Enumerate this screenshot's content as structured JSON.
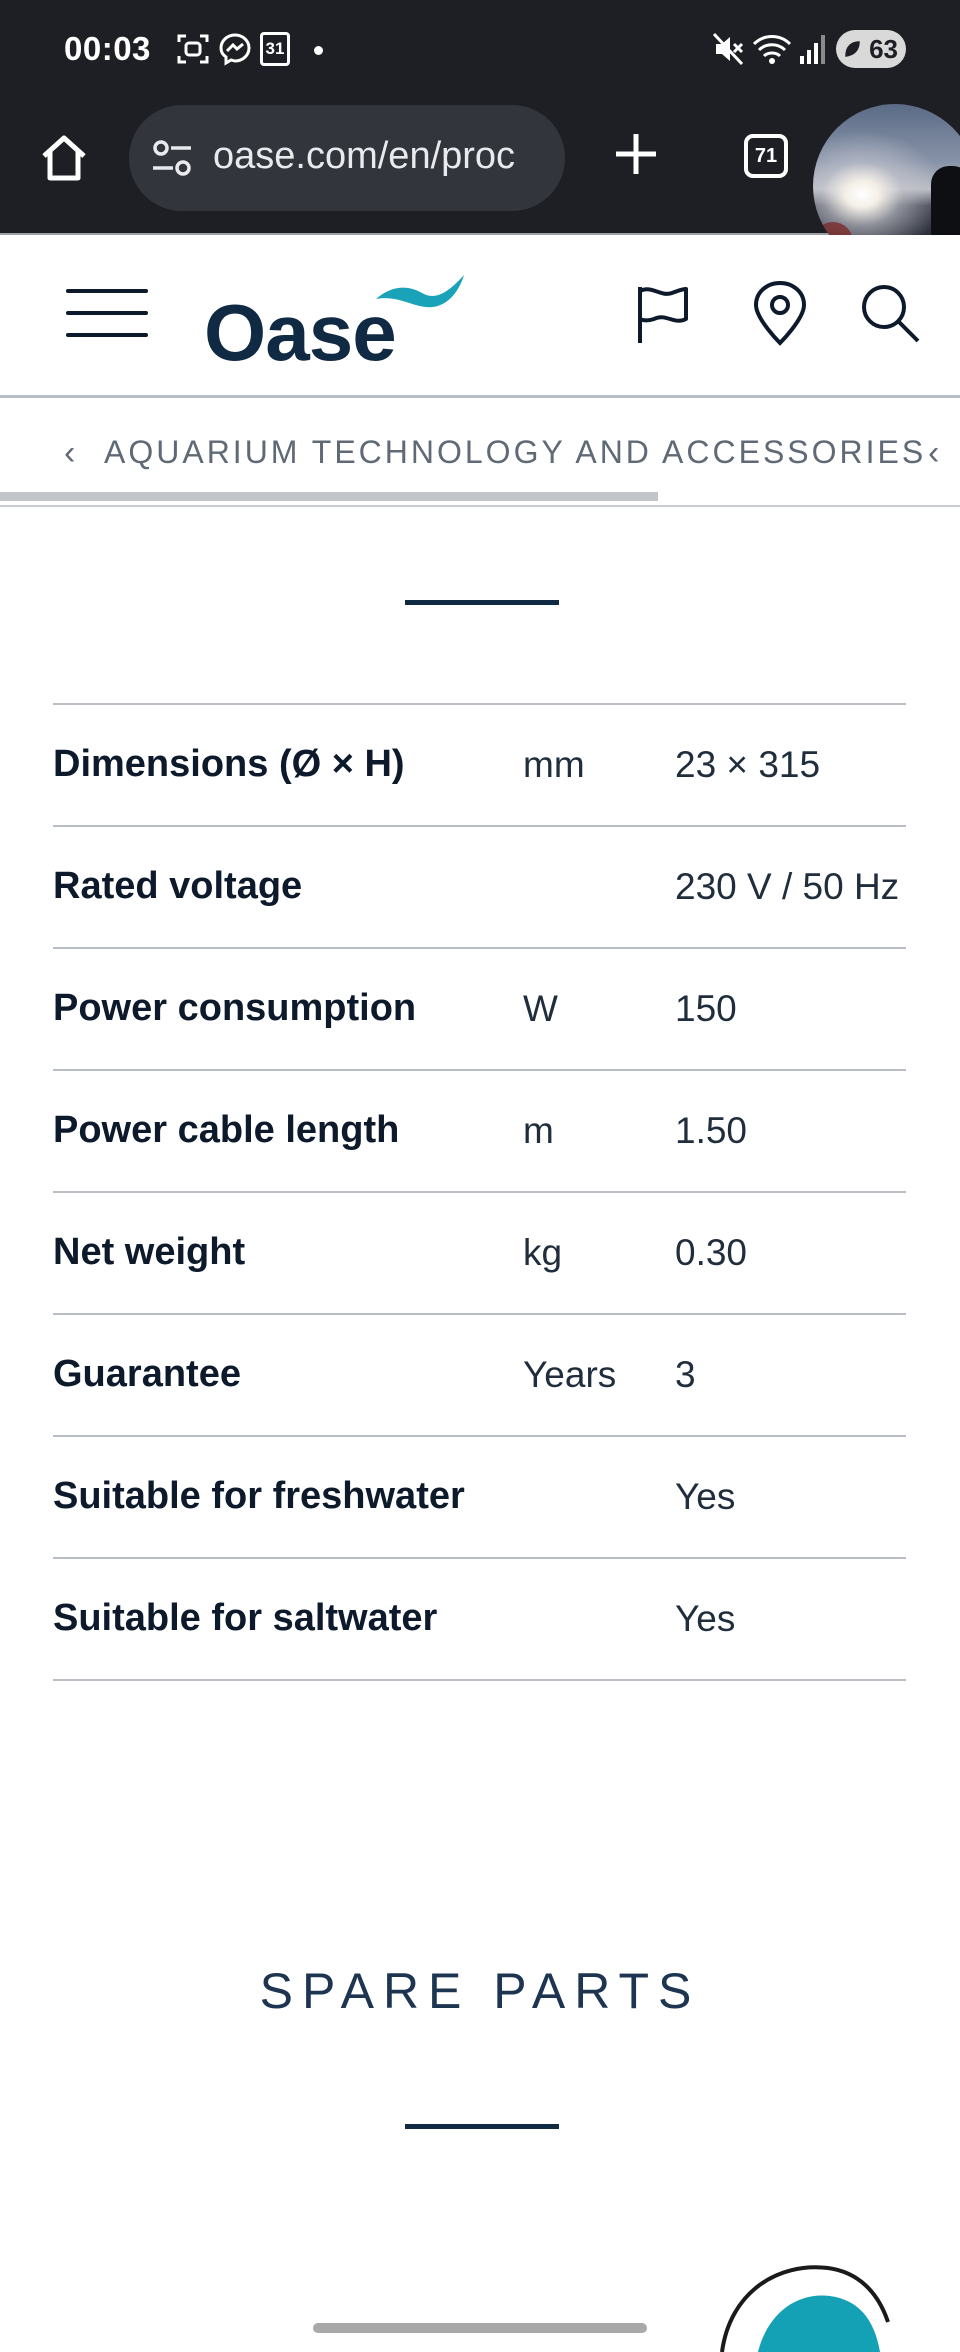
{
  "status_bar": {
    "time": "00:03",
    "calendar_day": "31",
    "battery": "63",
    "icons": [
      "screen-record-icon",
      "messenger-icon",
      "calendar-icon",
      "notification-dot-icon",
      "mute-icon",
      "wifi-icon",
      "signal-icon",
      "battery-icon"
    ]
  },
  "browser": {
    "url": "oase.com/en/proc",
    "tab_count": "71",
    "icons": [
      "home-icon",
      "site-settings-icon",
      "new-tab-plus-icon",
      "tab-switcher-icon",
      "chat-bubble-avatar"
    ]
  },
  "site_header": {
    "logo": "Oase",
    "icons": [
      "hamburger-menu-icon",
      "flag-icon",
      "location-pin-icon",
      "search-icon"
    ],
    "brand_colors": {
      "navy": "#112a44",
      "teal": "#1aa3b8"
    }
  },
  "breadcrumb": {
    "label": "AQUARIUM TECHNOLOGY AND ACCESSORIES",
    "prev_arrow": "‹",
    "next_arrow": "‹"
  },
  "specs": {
    "rows": [
      {
        "label": "Dimensions (Ø × H)",
        "unit": "mm",
        "value": "23 × 315"
      },
      {
        "label": "Rated voltage",
        "unit": "",
        "value": "230 V / 50 Hz"
      },
      {
        "label": "Power consumption",
        "unit": "W",
        "value": "150"
      },
      {
        "label": "Power cable length",
        "unit": "m",
        "value": "1.50"
      },
      {
        "label": "Net weight",
        "unit": "kg",
        "value": "0.30"
      },
      {
        "label": "Guarantee",
        "unit": "Years",
        "value": "3"
      },
      {
        "label": "Suitable for freshwater",
        "unit": "",
        "value": "Yes"
      },
      {
        "label": "Suitable for saltwater",
        "unit": "",
        "value": "Yes"
      }
    ]
  },
  "spare_parts": {
    "title": "SPARE PARTS"
  }
}
